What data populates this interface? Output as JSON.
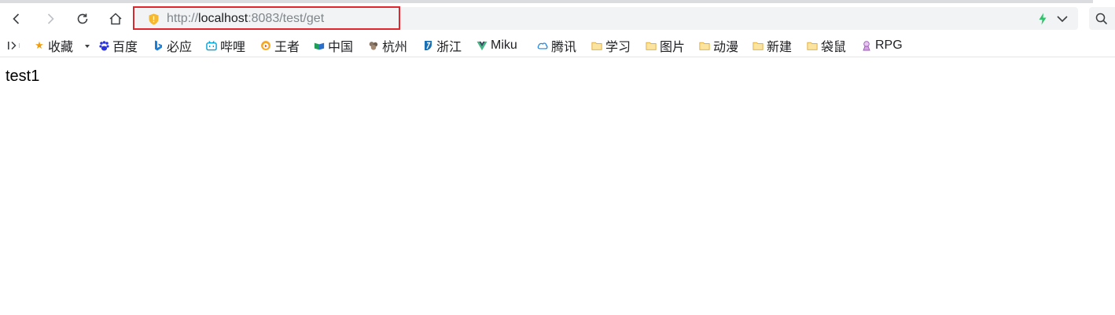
{
  "browser": {
    "address_bar": {
      "url_scheme": "http://",
      "url_host": "localhost",
      "url_rest": ":8083/test/get"
    },
    "bookmarks": [
      {
        "label": "收藏",
        "icon": "star-icon"
      },
      {
        "label": "百度",
        "icon": "baidu-icon"
      },
      {
        "label": "必应",
        "icon": "bing-icon"
      },
      {
        "label": "哔哩",
        "icon": "bilibili-icon"
      },
      {
        "label": "王者",
        "icon": "game-icon"
      },
      {
        "label": "中国",
        "icon": "flag-icon"
      },
      {
        "label": "杭州",
        "icon": "site-icon"
      },
      {
        "label": "浙江",
        "icon": "site-icon"
      },
      {
        "label": "Miku",
        "icon": "vue-icon"
      },
      {
        "label": "腾讯",
        "icon": "cloud-icon"
      },
      {
        "label": "学习",
        "icon": "folder-icon"
      },
      {
        "label": "图片",
        "icon": "folder-icon"
      },
      {
        "label": "动漫",
        "icon": "folder-icon"
      },
      {
        "label": "新建",
        "icon": "folder-icon"
      },
      {
        "label": "袋鼠",
        "icon": "folder-icon"
      },
      {
        "label": "RPG",
        "icon": "rpg-icon"
      }
    ]
  },
  "page": {
    "body_text": "test1"
  },
  "colors": {
    "highlight": "#e0262c",
    "omnibox_bg": "#f1f3f4",
    "folder": "#f5c84c",
    "star": "#f29d0c"
  }
}
